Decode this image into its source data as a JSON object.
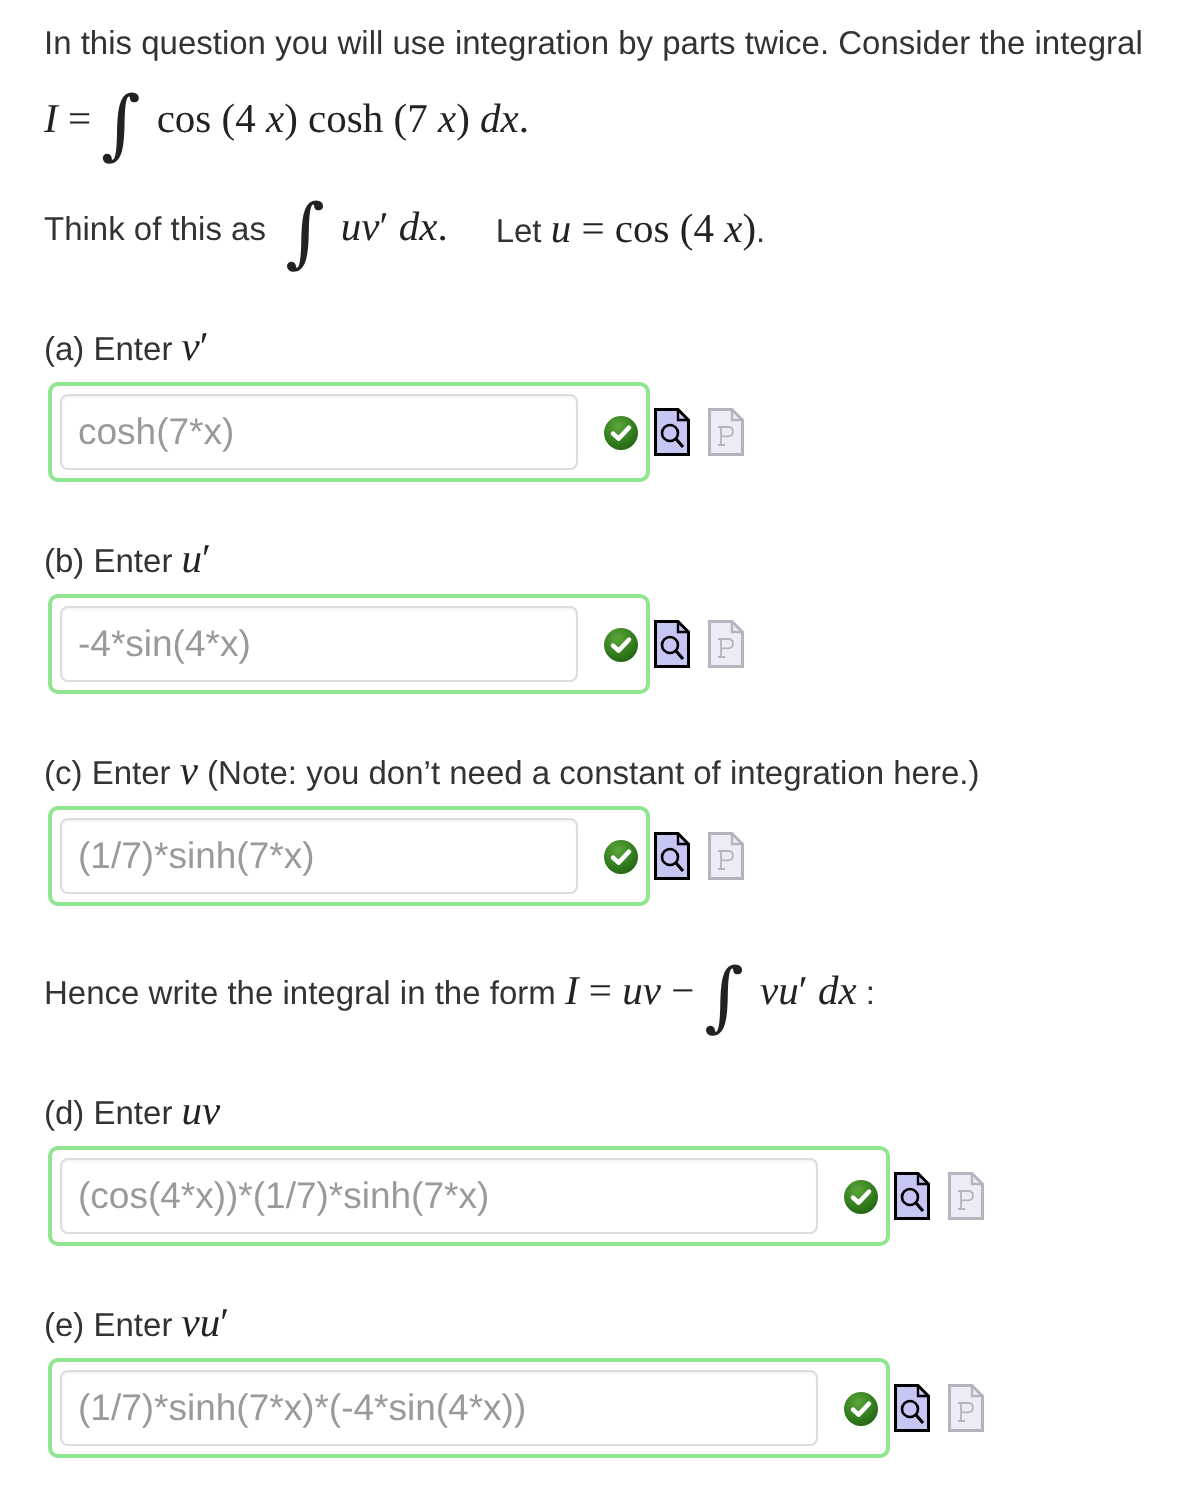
{
  "content": [
    {
      "kind": "paragraph",
      "phrases": [
        [
          {
            "kind": "text",
            "text": "In this question you will use integration by parts twice. Consider the integral"
          }
        ]
      ]
    },
    {
      "kind": "paragraph",
      "phrases": [
        [
          {
            "kind": "math",
            "text": "*I* ="
          },
          {
            "kind": "integral",
            "text": "∫"
          },
          {
            "kind": "math",
            "text": "cos (4 *x*) cosh (7 *x*) *dx*."
          }
        ]
      ]
    },
    {
      "kind": "paragraph",
      "phrases": [
        [
          {
            "kind": "text",
            "text": "Think of this as "
          },
          {
            "kind": "integral",
            "text": "∫"
          },
          {
            "kind": "math",
            "text": "*uv*′ *dx*."
          }
        ],
        [
          {
            "kind": "text",
            "text": "Let "
          },
          {
            "kind": "math",
            "text": "*u* = cos (4 *x*)"
          },
          {
            "kind": "text",
            "text": "."
          }
        ]
      ]
    },
    {
      "kind": "part",
      "label": [
        {
          "kind": "text",
          "text": "(a) Enter "
        },
        {
          "kind": "math",
          "text": "*v*′"
        }
      ],
      "answer": {
        "value": "cosh(7*x)",
        "correct": true
      },
      "tools": [
        {
          "kind": "preview",
          "disabled": false
        },
        {
          "kind": "page",
          "disabled": true
        }
      ]
    },
    {
      "kind": "part",
      "label": [
        {
          "kind": "text",
          "text": "(b) Enter "
        },
        {
          "kind": "math",
          "text": "*u*′"
        }
      ],
      "answer": {
        "value": "-4*sin(4*x)",
        "correct": true
      },
      "tools": [
        {
          "kind": "preview",
          "disabled": false
        },
        {
          "kind": "page",
          "disabled": true
        }
      ]
    },
    {
      "kind": "part",
      "label": [
        {
          "kind": "text",
          "text": "(c) Enter "
        },
        {
          "kind": "math",
          "text": "*v*"
        },
        {
          "kind": "text",
          "text": " (Note: you don’t need a constant of integration here.)"
        }
      ],
      "answer": {
        "value": "(1/7)*sinh(7*x)",
        "correct": true
      },
      "tools": [
        {
          "kind": "preview",
          "disabled": false
        },
        {
          "kind": "page",
          "disabled": true
        }
      ]
    },
    {
      "kind": "paragraph",
      "phrases": [
        [
          {
            "kind": "text",
            "text": "Hence write the integral in the form "
          },
          {
            "kind": "math",
            "text": "*I* = *uv* −"
          },
          {
            "kind": "integral",
            "text": "∫"
          },
          {
            "kind": "math",
            "text": "*vu*′ *dx*"
          },
          {
            "kind": "text",
            "text": " :"
          }
        ]
      ]
    },
    {
      "kind": "part",
      "label": [
        {
          "kind": "text",
          "text": "(d) Enter "
        },
        {
          "kind": "math",
          "text": "*uv*"
        }
      ],
      "answer": {
        "value": "(cos(4*x))*(1/7)*sinh(7*x)",
        "correct": true
      },
      "tools": [
        {
          "kind": "preview",
          "disabled": false
        },
        {
          "kind": "page",
          "disabled": true
        }
      ]
    },
    {
      "kind": "part",
      "label": [
        {
          "kind": "text",
          "text": "(e) Enter "
        },
        {
          "kind": "math",
          "text": "*vu*′"
        }
      ],
      "answer": {
        "value": "(1/7)*sinh(7*x)*(-4*sin(4*x))",
        "correct": true
      },
      "tools": [
        {
          "kind": "preview",
          "disabled": false
        },
        {
          "kind": "page",
          "disabled": true
        }
      ]
    }
  ]
}
